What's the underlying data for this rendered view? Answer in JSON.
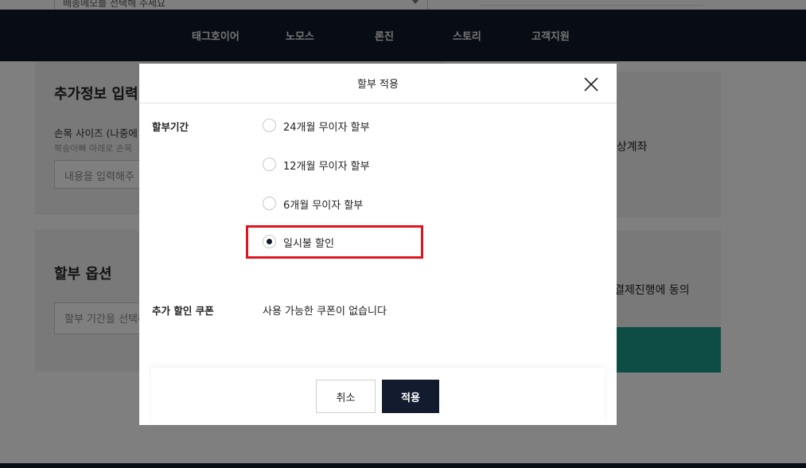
{
  "background": {
    "top_select_placeholder": "배송메모를 선택해 주세요",
    "nav": [
      "태그호이어",
      "노모스",
      "론진",
      "스토리",
      "고객지원"
    ],
    "extra_info_title": "추가정보 입력",
    "wrist_label": "손목 사이즈 (나중에",
    "wrist_hint": "복숭아뼈 아래로 손목",
    "wrist_input_placeholder": "내용을 입력해주",
    "installment_title": "할부 옵션",
    "installment_select_placeholder": "할부 기간을 선택해",
    "right_text_1": "가상계좌",
    "right_text_2": "결제진행에 동의"
  },
  "modal": {
    "title": "할부 적용",
    "period_label": "할부기간",
    "options": [
      {
        "label": "24개월 무이자 할부",
        "checked": false
      },
      {
        "label": "12개월 무이자 할부",
        "checked": false
      },
      {
        "label": "6개월 무이자 할부",
        "checked": false
      },
      {
        "label": "일시불 할인",
        "checked": true
      }
    ],
    "coupon_label": "추가 할인 쿠폰",
    "coupon_text": "사용 가능한 쿠폰이 없습니다",
    "cancel_label": "취소",
    "apply_label": "적용"
  },
  "colors": {
    "navbar": "#111a2b",
    "apply_button": "#121c2e",
    "highlight": "#e0141e",
    "teal": "#1d9b8a"
  }
}
